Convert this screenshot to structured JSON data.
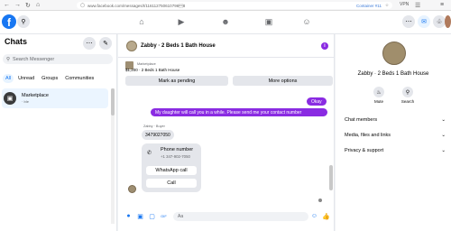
{
  "browser": {
    "url": "www.facebook.com/messages/t/116112750610796\u00038",
    "container_label": "Container #11"
  },
  "topnav": {
    "logo": "f"
  },
  "left": {
    "title": "Chats",
    "search_placeholder": "Search Messenger",
    "filters": [
      "All",
      "Unread",
      "Groups",
      "Communities"
    ],
    "chat": {
      "name": "Marketplace",
      "sub": "· bIe"
    }
  },
  "conversation": {
    "title": "Zabby · 2 Beds 1 Bath House",
    "marketplace_label": "Marketplace",
    "listing": "$1,200 · 2 Beds 1 Bath House",
    "mark_pending": "Mark as pending",
    "more_options": "More options",
    "messages": {
      "okay": "Okay",
      "daughter": "My daughter will call you in a while. Please send me your contact number",
      "sender_label": "Zabby · Buyer",
      "number": "3479027050",
      "phone_title": "Phone number",
      "phone_value": "+1 347-902-7050",
      "whatsapp": "WhatsApp call",
      "call": "Call"
    },
    "composer_placeholder": "Aa"
  },
  "right": {
    "name": "Zabby · 2 Beds 1 Bath House",
    "mute": "Mute",
    "search": "Search",
    "rows": [
      "Chat members",
      "Media, files and links",
      "Privacy & support"
    ]
  },
  "colors": {
    "accent_purple": "#8a2be2",
    "fb_blue": "#1877f2"
  }
}
